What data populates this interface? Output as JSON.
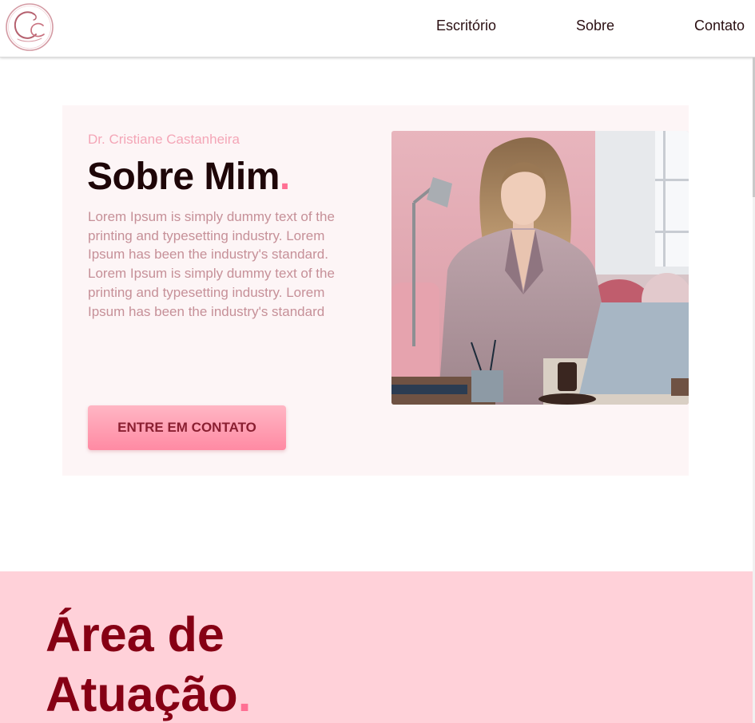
{
  "nav": {
    "links": [
      "Escritório",
      "Sobre",
      "Contato"
    ]
  },
  "icons": {
    "logo": "cc-monogram-logo"
  },
  "about": {
    "eyebrow": "Dr. Cristiane Castanheira",
    "title": "Sobre Mim",
    "title_accent": ".",
    "body": "Lorem Ipsum is simply dummy text of the printing and typesetting industry. Lorem Ipsum has been the industry's standard. Lorem Ipsum is simply dummy text of the printing and typesetting industry. Lorem Ipsum has been the industry's standard",
    "cta_label": "ENTRE EM CONTATO"
  },
  "area": {
    "title_line1": "Área de",
    "title_line2": "Atuação",
    "title_accent": "."
  },
  "colors": {
    "accent": "#ff6f93",
    "heading_dark": "#1e0608",
    "area_heading": "#860014",
    "card_bg": "#fdf5f6",
    "section_bg": "#ffd1d9"
  }
}
